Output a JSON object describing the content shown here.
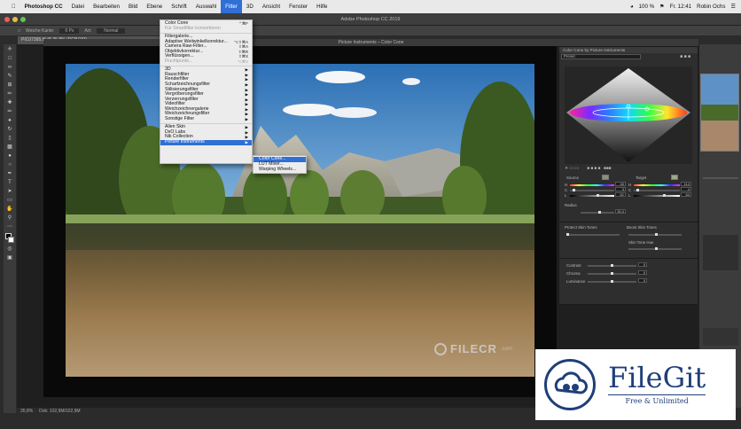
{
  "menubar": {
    "apple": "",
    "items": [
      "Photoshop CC",
      "Datei",
      "Bearbeiten",
      "Bild",
      "Ebene",
      "Schrift",
      "Auswahl",
      "Filter",
      "3D",
      "Ansicht",
      "Fenster",
      "Hilfe"
    ],
    "active_index": 7,
    "time": "Fr. 12:41",
    "user": "Robin Ochs",
    "battery": "100 %"
  },
  "window": {
    "title": "Adobe Photoshop CC 2019"
  },
  "options_bar": {
    "feather_label": "Weiche Kante:",
    "feather_value": "0 Px",
    "style_label": "Art:",
    "style_value": "Normal"
  },
  "document": {
    "tab": "PIC07395.tif @ 35,8% (RGB/16*)",
    "zoom": "35,8%",
    "doc_info": "Dok: 102,9M/102,9M"
  },
  "plugin_window": {
    "title": "Picture Instruments – Color Cone"
  },
  "filter_menu": {
    "items": [
      {
        "label": "Color Cone",
        "shortcut": "⌃⌘F"
      },
      {
        "label": "Für Smartfilter konvertieren",
        "disabled": true
      },
      {
        "sep": true
      },
      {
        "label": "Filtergalerie..."
      },
      {
        "label": "Adaptive Weitwinkelkorrektur...",
        "shortcut": "⌥⇧⌘A"
      },
      {
        "label": "Camera Raw-Filter...",
        "shortcut": "⇧⌘A"
      },
      {
        "label": "Objektivkorrektur...",
        "shortcut": "⇧⌘R"
      },
      {
        "label": "Verflüssigen...",
        "shortcut": "⇧⌘X"
      },
      {
        "label": "Fluchtpunkt...",
        "shortcut": "⌥⌘V",
        "disabled": true
      },
      {
        "sep": true
      },
      {
        "label": "3D",
        "sub": true
      },
      {
        "label": "Rauschfilter",
        "sub": true
      },
      {
        "label": "Renderfilter",
        "sub": true
      },
      {
        "label": "Scharfzeichnungsfilter",
        "sub": true
      },
      {
        "label": "Stilisierungsfilter",
        "sub": true
      },
      {
        "label": "Vergröberungsfilter",
        "sub": true
      },
      {
        "label": "Verzerrungsfilter",
        "sub": true
      },
      {
        "label": "Videofilter",
        "sub": true
      },
      {
        "label": "Weichzeichnergalerie",
        "sub": true
      },
      {
        "label": "Weichzeichnungsfilter",
        "sub": true
      },
      {
        "label": "Sonstige Filter",
        "sub": true
      },
      {
        "sep": true
      },
      {
        "label": "Alien Skin",
        "sub": true
      },
      {
        "label": "DxO Labs",
        "sub": true
      },
      {
        "label": "Nik Collection",
        "sub": true
      },
      {
        "label": "Picture Instruments",
        "sub": true,
        "highlight": true
      }
    ]
  },
  "submenu": {
    "items": [
      {
        "label": "Color Cone...",
        "highlight": true
      },
      {
        "label": "LUT Mixer..."
      },
      {
        "label": "Warping Wheels..."
      }
    ]
  },
  "panel": {
    "title": "Color Cone by Picture Instruments",
    "preset": "Preset",
    "source_label": "Source",
    "target_label": "Target",
    "source": {
      "H": "40",
      "C": "3",
      "L": "61"
    },
    "target": {
      "H": "114",
      "C": "4",
      "L": "64"
    },
    "radius_label": "Radius",
    "radius_value": "39.4",
    "protect_label": "Protect Skin Tones",
    "boost_label": "Boost Skin Tones",
    "skin_hue_label": "Skin Tone Hue",
    "contrast_label": "Contrast",
    "chroma_label": "Chroma",
    "luminance_label": "Luminance",
    "contrast_value": "0",
    "chroma_value": "0",
    "luminance_value": "0"
  },
  "watermarks": {
    "filecr": "FILECR",
    "filecr_sub": ".com",
    "filegit_name": "FileGit",
    "filegit_tag": "Free & Unlimited"
  },
  "colors": {
    "menu_highlight": "#2f6fd6",
    "filegit_blue": "#1f3f7a"
  }
}
